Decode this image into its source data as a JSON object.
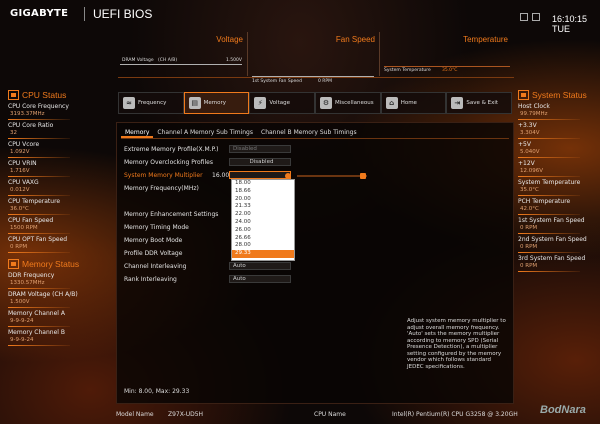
{
  "header": {
    "brand": "GIGABYTE",
    "product": "UEFI BIOS",
    "time": "16:10:15 TUE"
  },
  "monitor": {
    "voltage": {
      "title": "Voltage",
      "label": "DRAM Voltage",
      "channel": "(CH A/B)",
      "value": "1.500V"
    },
    "fan": {
      "title": "Fan Speed",
      "label": "1st System Fan Speed",
      "value": "0 RPM"
    },
    "temp": {
      "title": "Temperature",
      "label": "System Temperature",
      "value": "35.0°C"
    }
  },
  "cpu_status": {
    "title": "CPU Status",
    "items": [
      {
        "label": "CPU Core Frequency",
        "value": "3193.37MHz"
      },
      {
        "label": "CPU Core Ratio",
        "value": "32"
      },
      {
        "label": "CPU Vcore",
        "value": "1.092V"
      },
      {
        "label": "CPU VRIN",
        "value": "1.716V"
      },
      {
        "label": "CPU VAXG",
        "value": "0.012V"
      },
      {
        "label": "CPU Temperature",
        "value": "36.0°C"
      },
      {
        "label": "CPU Fan Speed",
        "value": "1500 RPM"
      },
      {
        "label": "CPU OPT Fan Speed",
        "value": "0 RPM"
      }
    ]
  },
  "memory_status": {
    "title": "Memory Status",
    "items": [
      {
        "label": "DDR Frequency",
        "value": "1330.57MHz"
      },
      {
        "label": "DRAM Voltage",
        "channel": "(CH A/B)",
        "value": "1.500V"
      },
      {
        "label": "Memory Channel A",
        "value": "9-9-9-24"
      },
      {
        "label": "Memory Channel B",
        "value": "9-9-9-24"
      }
    ]
  },
  "system_status": {
    "title": "System Status",
    "items": [
      {
        "label": "Host Clock",
        "value": "99.79MHz"
      },
      {
        "label": "+3.3V",
        "value": "3.304V"
      },
      {
        "label": "+5V",
        "value": "5.040V"
      },
      {
        "label": "+12V",
        "value": "12.096V"
      },
      {
        "label": "System Temperature",
        "value": "35.0°C"
      },
      {
        "label": "PCH Temperature",
        "value": "42.0°C"
      },
      {
        "label": "1st System Fan Speed",
        "value": "0 RPM"
      },
      {
        "label": "2nd System Fan Speed",
        "value": "0 RPM"
      },
      {
        "label": "3rd System Fan Speed",
        "value": "0 RPM"
      }
    ]
  },
  "tabs": [
    {
      "label": "Frequency",
      "icon": "frequency-icon"
    },
    {
      "label": "Memory",
      "icon": "memory-icon"
    },
    {
      "label": "Voltage",
      "icon": "voltage-icon"
    },
    {
      "label": "Miscellaneous",
      "icon": "gear-icon"
    },
    {
      "label": "Home",
      "icon": "home-icon"
    },
    {
      "label": "Save & Exit",
      "icon": "exit-icon"
    }
  ],
  "subtabs": [
    "Memory",
    "Channel A Memory Sub Timings",
    "Channel B Memory Sub Timings"
  ],
  "options": {
    "xmp": {
      "label": "Extreme Memory Profile(X.M.P.)",
      "value": "Disabled"
    },
    "oc_profiles": {
      "label": "Memory Overclocking Profiles",
      "value": "Disabled"
    },
    "multiplier": {
      "label": "System Memory Multiplier",
      "current": "16.00",
      "value": ""
    },
    "frequency": {
      "label": "Memory Frequency(MHz)",
      "value": ""
    },
    "enhancement": {
      "label": "Memory Enhancement Settings",
      "value": ""
    },
    "timing_mode": {
      "label": "Memory Timing Mode",
      "value": ""
    },
    "boot_mode": {
      "label": "Memory Boot Mode",
      "value": ""
    },
    "profile_ddr": {
      "label": "Profile DDR Voltage",
      "value": ""
    },
    "ch_interleave": {
      "label": "Channel Interleaving",
      "value": "Auto"
    },
    "rank_interleave": {
      "label": "Rank Interleaving",
      "value": "Auto"
    }
  },
  "dropdown": {
    "items": [
      "18.00",
      "18.66",
      "20.00",
      "21.33",
      "22.00",
      "24.00",
      "26.00",
      "26.66",
      "28.00",
      "29.33"
    ],
    "highlighted_index": 9
  },
  "help_text": "Adjust system memory multiplier to adjust overall memory frequency.\n'Auto' sets the memory multiplier according to memory SPD (Serial Presence Detection), a multiplier setting configured by the memory vendor which follows standard JEDEC specifications.",
  "minmax": "Min: 8.00, Max: 29.33",
  "footer": {
    "model_label": "Model Name",
    "model_value": "Z97X-UD5H",
    "cpu_label": "CPU Name",
    "cpu_value": "Intel(R) Pentium(R) CPU G3258 @ 3.20GH"
  },
  "watermark": "BodNara",
  "colors": {
    "accent": "#f07a1c",
    "highlight": "#f07a1c",
    "background": "#0d0807"
  }
}
